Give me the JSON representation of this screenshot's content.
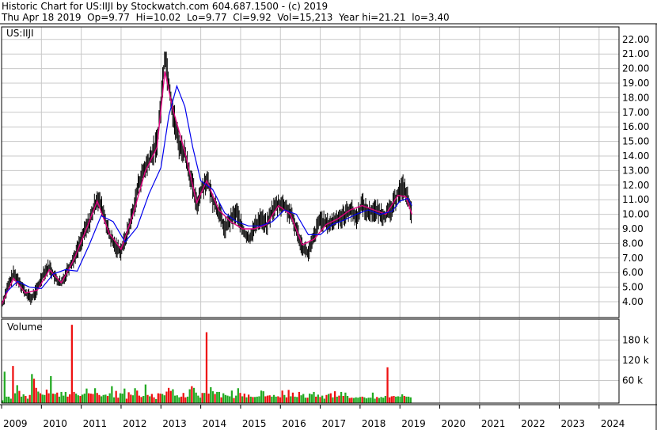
{
  "header": {
    "line1": "Historic Chart for US:IIJI by Stockwatch.com 604.687.1500 - (c) 2019",
    "line2": "Thu Apr 18 2019  Op=9.77  Hi=10.02  Lo=9.77  Cl=9.92  Vol=15,213  Year hi=21.21  lo=3.40"
  },
  "ticker_label": "US:IIJI",
  "volume_label": "Volume",
  "colors": {
    "grid": "#c8c8c8",
    "price_bar": "#000000",
    "ma_short": "#e0007f",
    "ma_long": "#0000ee",
    "vol_up": "#22aa22",
    "vol_down": "#ee1111"
  },
  "chart_data": [
    {
      "type": "line",
      "title": "",
      "ylabel": "",
      "ylim": [
        3.3,
        22.4
      ],
      "y_ticks": [
        "4.00",
        "5.00",
        "6.00",
        "7.00",
        "8.00",
        "9.00",
        "10.00",
        "11.00",
        "12.00",
        "13.00",
        "14.00",
        "15.00",
        "16.00",
        "17.00",
        "18.00",
        "19.00",
        "20.00",
        "21.00",
        "22.00"
      ],
      "x_ticks": [
        "2009",
        "2010",
        "2011",
        "2012",
        "2013",
        "2014",
        "2015",
        "2016",
        "2017",
        "2018",
        "2019",
        "2020",
        "2021",
        "2022",
        "2023",
        "2024"
      ],
      "xlim": [
        2009.0,
        2024.5
      ],
      "series": [
        {
          "style": "ohlc",
          "x": [
            2009.0,
            2009.15,
            2009.3,
            2009.45,
            2009.6,
            2009.75,
            2009.9,
            2010.05,
            2010.2,
            2010.35,
            2010.5,
            2010.65,
            2010.8,
            2010.95,
            2011.1,
            2011.25,
            2011.4,
            2011.55,
            2011.7,
            2011.85,
            2012.0,
            2012.15,
            2012.3,
            2012.45,
            2012.6,
            2012.75,
            2012.9,
            2013.0,
            2013.1,
            2013.2,
            2013.3,
            2013.45,
            2013.6,
            2013.75,
            2013.9,
            2014.0,
            2014.15,
            2014.3,
            2014.45,
            2014.6,
            2014.75,
            2014.9,
            2015.05,
            2015.2,
            2015.35,
            2015.5,
            2015.65,
            2015.8,
            2015.95,
            2016.1,
            2016.25,
            2016.4,
            2016.55,
            2016.7,
            2016.85,
            2017.0,
            2017.15,
            2017.3,
            2017.45,
            2017.6,
            2017.75,
            2017.9,
            2018.05,
            2018.2,
            2018.35,
            2018.5,
            2018.65,
            2018.8,
            2018.95,
            2019.1,
            2019.2,
            2019.3
          ],
          "y": [
            3.7,
            5.0,
            5.9,
            5.4,
            4.6,
            4.2,
            4.9,
            6.0,
            6.4,
            5.6,
            5.2,
            6.2,
            6.9,
            7.9,
            8.9,
            9.8,
            11.2,
            10.2,
            8.6,
            7.8,
            7.5,
            8.7,
            10.2,
            12.2,
            13.1,
            13.9,
            14.9,
            17.5,
            21.0,
            19.0,
            17.0,
            14.8,
            14.2,
            12.5,
            10.6,
            11.6,
            12.4,
            11.0,
            10.2,
            9.0,
            9.6,
            10.2,
            8.9,
            8.3,
            9.1,
            9.8,
            9.2,
            10.3,
            10.7,
            10.6,
            10.0,
            9.0,
            7.8,
            7.3,
            8.5,
            9.7,
            9.3,
            9.4,
            9.8,
            9.9,
            10.4,
            9.7,
            10.7,
            10.1,
            10.3,
            10.1,
            9.9,
            10.4,
            11.5,
            11.9,
            11.0,
            9.92
          ]
        },
        {
          "name": "",
          "style": "ma-short",
          "x": [
            2009.0,
            2009.3,
            2009.6,
            2009.9,
            2010.2,
            2010.5,
            2010.8,
            2011.1,
            2011.4,
            2011.7,
            2012.0,
            2012.3,
            2012.6,
            2012.9,
            2013.1,
            2013.3,
            2013.6,
            2013.9,
            2014.15,
            2014.45,
            2014.75,
            2015.05,
            2015.35,
            2015.65,
            2015.95,
            2016.25,
            2016.55,
            2016.85,
            2017.15,
            2017.45,
            2017.75,
            2018.05,
            2018.35,
            2018.65,
            2018.95,
            2019.15,
            2019.3
          ],
          "y": [
            3.8,
            5.6,
            4.6,
            4.8,
            6.2,
            5.3,
            6.8,
            8.8,
            10.9,
            8.7,
            7.6,
            10.0,
            12.9,
            14.6,
            19.8,
            17.2,
            14.3,
            10.8,
            12.3,
            10.3,
            9.5,
            9.0,
            9.0,
            9.3,
            10.6,
            10.0,
            7.9,
            8.3,
            9.3,
            9.7,
            10.3,
            10.6,
            10.3,
            10.0,
            11.3,
            11.2,
            10.0
          ]
        },
        {
          "name": "",
          "style": "ma-long",
          "x": [
            2009.1,
            2009.4,
            2009.7,
            2010.0,
            2010.3,
            2010.6,
            2010.9,
            2011.2,
            2011.5,
            2011.8,
            2012.1,
            2012.4,
            2012.7,
            2013.0,
            2013.2,
            2013.4,
            2013.6,
            2013.8,
            2014.0,
            2014.3,
            2014.6,
            2014.9,
            2015.2,
            2015.5,
            2015.8,
            2016.1,
            2016.4,
            2016.7,
            2017.0,
            2017.3,
            2017.6,
            2017.9,
            2018.2,
            2018.5,
            2018.8,
            2019.0,
            2019.2,
            2019.3
          ],
          "y": [
            4.6,
            5.4,
            5.0,
            4.9,
            5.9,
            6.2,
            6.1,
            7.9,
            9.9,
            9.5,
            8.1,
            9.1,
            11.4,
            13.2,
            16.8,
            18.8,
            17.4,
            14.6,
            12.3,
            11.7,
            10.1,
            9.5,
            9.2,
            9.2,
            9.5,
            10.3,
            10.0,
            8.6,
            8.6,
            9.3,
            9.6,
            10.0,
            10.3,
            10.0,
            10.2,
            10.9,
            11.1,
            10.6
          ]
        }
      ]
    },
    {
      "type": "bar",
      "title": "Volume",
      "ylim": [
        0,
        225000
      ],
      "y_ticks": [
        "60 k",
        "120 k",
        "180 k"
      ],
      "x_range": [
        2009.0,
        2019.3
      ],
      "values": [
        1200,
        86000,
        12000,
        12000,
        6000,
        103000,
        22000,
        46000,
        29000,
        12000,
        19000,
        14000,
        6000,
        17000,
        79000,
        65000,
        38000,
        27000,
        22000,
        18000,
        17000,
        33000,
        22000,
        73000,
        21000,
        20000,
        24000,
        12000,
        26000,
        15000,
        26000,
        12000,
        19000,
        225000,
        26000,
        21000,
        16000,
        14000,
        18000,
        21000,
        36000,
        22000,
        21000,
        20000,
        37000,
        23000,
        17000,
        13000,
        17000,
        18000,
        14000,
        22000,
        43000,
        10000,
        29000,
        9000,
        22000,
        21000,
        36000,
        6000,
        25000,
        18000,
        16000,
        37000,
        30000,
        15000,
        11000,
        14000,
        48000,
        17000,
        13000,
        20000,
        10000,
        5000,
        22000,
        21000,
        20000,
        16000,
        27000,
        38000,
        29000,
        34000,
        15000,
        16000,
        10000,
        12000,
        23000,
        10000,
        12000,
        34000,
        43000,
        38000,
        24000,
        15000,
        9000,
        23000,
        23000,
        203000,
        21000,
        40000,
        28000,
        20000,
        26000,
        26000,
        10000,
        22000,
        17000,
        15000,
        13000,
        30000,
        8000,
        15000,
        37000,
        23000,
        13000,
        21000,
        10000,
        18000,
        12000,
        11000,
        11000,
        12000,
        13000,
        30000,
        28000,
        13000,
        15000,
        16000,
        12000,
        17000,
        12000,
        13000,
        10000,
        30000,
        17000,
        10000,
        32000,
        13000,
        24000,
        12000,
        11000,
        26000,
        16000,
        20000,
        9000,
        9000,
        21000,
        19000,
        26000,
        12000,
        18000,
        11000,
        15000,
        6000,
        17000,
        20000,
        22000,
        10000,
        28000,
        12000,
        15000,
        26000,
        14000,
        24000,
        14000,
        8000,
        9000,
        8000,
        10000,
        9000,
        11000,
        12000,
        10000,
        7000,
        9000,
        9000,
        24000,
        6000,
        11000,
        8000,
        11000,
        9000,
        14000,
        99000,
        10000,
        13000,
        14000,
        12000,
        13000,
        12000,
        19000,
        14000,
        12000,
        12000,
        10000
      ],
      "up": [
        1,
        1,
        1,
        1,
        1,
        0,
        1,
        1,
        0,
        1,
        1,
        0,
        1,
        0,
        1,
        0,
        0,
        1,
        0,
        1,
        1,
        0,
        0,
        1,
        0,
        1,
        0,
        1,
        1,
        1,
        1,
        0,
        0,
        0,
        0,
        1,
        1,
        0,
        1,
        1,
        1,
        0,
        0,
        0,
        1,
        0,
        0,
        1,
        1,
        1,
        0,
        1,
        1,
        1,
        0,
        0,
        1,
        1,
        1,
        0,
        0,
        0,
        1,
        1,
        0,
        0,
        0,
        1,
        1,
        0,
        1,
        0,
        0,
        1,
        0,
        0,
        1,
        1,
        0,
        0,
        0,
        1,
        1,
        1,
        1,
        0,
        0,
        0,
        1,
        1,
        0,
        1,
        1,
        1,
        1,
        0,
        1,
        0,
        0,
        1,
        1,
        0,
        1,
        1,
        0,
        1,
        1,
        1,
        1,
        1,
        0,
        1,
        1,
        0,
        1,
        0,
        1,
        0,
        1,
        0,
        1,
        1,
        1,
        1,
        1,
        0,
        0,
        0,
        1,
        1,
        1,
        0,
        0,
        0,
        1,
        0,
        0,
        1,
        0,
        1,
        1,
        0,
        1,
        1,
        1,
        0,
        1,
        1,
        1,
        0,
        1,
        0,
        1,
        1,
        0,
        1,
        0,
        1,
        0,
        1,
        0,
        1,
        0,
        1,
        1,
        0,
        0,
        1,
        1,
        1,
        1,
        0,
        1,
        1,
        1,
        1,
        1,
        1,
        0,
        1,
        1,
        1,
        1,
        0,
        0,
        0,
        0,
        1,
        1,
        1,
        1,
        0,
        1,
        1,
        1,
        0,
        1,
        0
      ]
    }
  ]
}
